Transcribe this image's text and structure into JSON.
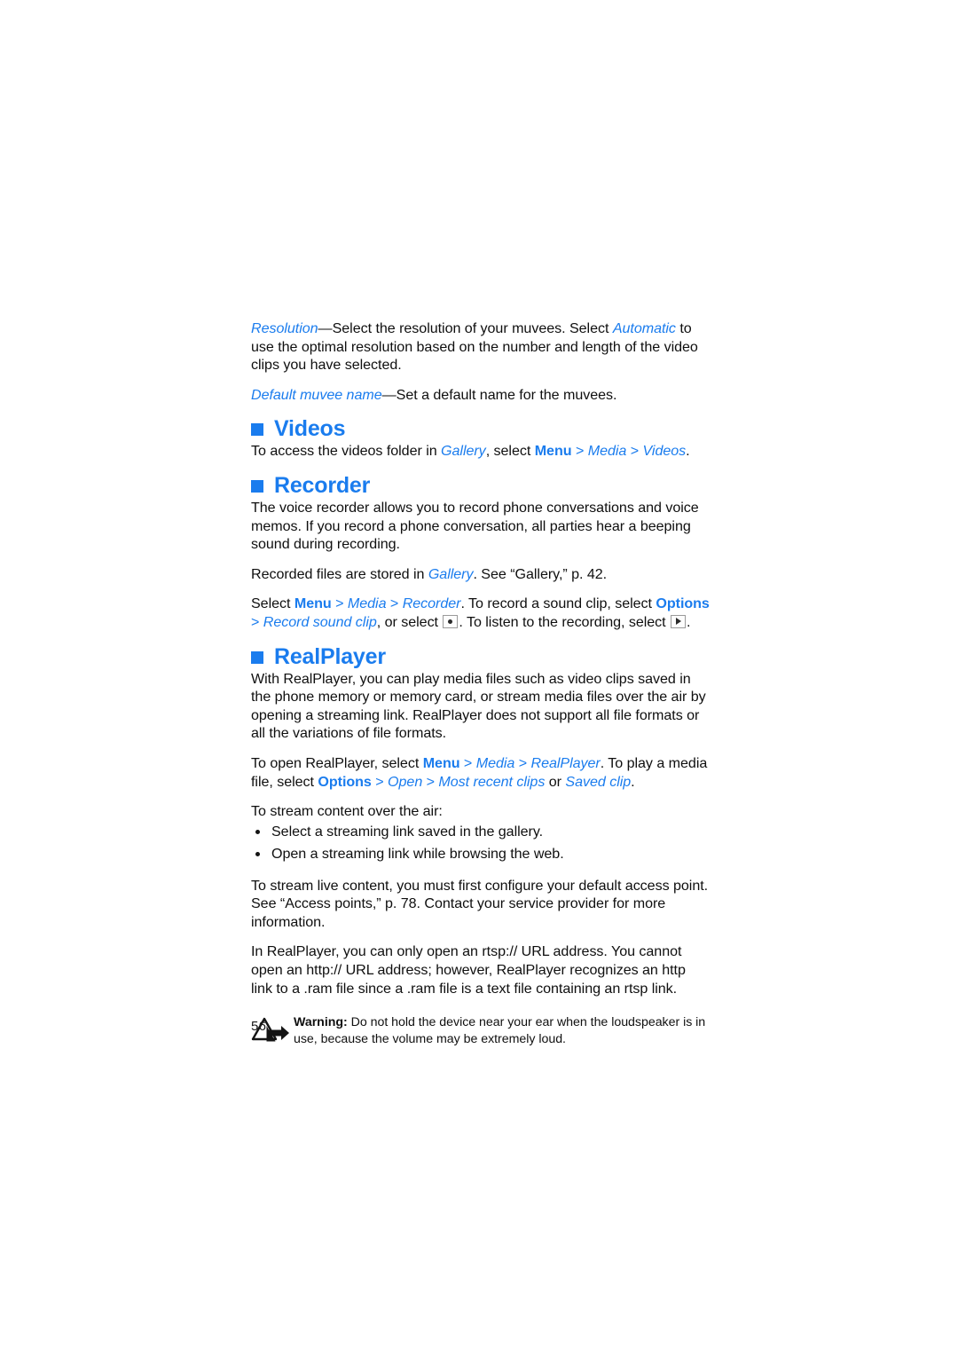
{
  "document": {
    "page_number": "56",
    "accent_color": "#1a7cee",
    "text_color": "#0f0f0f"
  },
  "muvee_settings": {
    "resolution": {
      "term": "Resolution",
      "dash": "—",
      "text_1": "Select the resolution of your muvees. Select ",
      "term_2": "Automatic",
      "text_2": " to use the optimal resolution based on the number and length of the video clips you have selected."
    },
    "default_name": {
      "term": "Default muvee name",
      "dash": "—",
      "text": "Set a default name for the muvees."
    }
  },
  "videos": {
    "heading": "Videos",
    "icon": "blue-square-bullet",
    "intro": {
      "text_1": "To access the videos folder in ",
      "term_gallery": "Gallery",
      "text_2": ", select ",
      "softkey_menu": "Menu",
      "sep_1": " > ",
      "item_media": "Media",
      "sep_2": " > ",
      "item_videos": "Videos",
      "text_3": "."
    }
  },
  "recorder": {
    "heading": "Recorder",
    "icon": "blue-square-bullet",
    "paragraph_1": "The voice recorder allows you to record phone conversations and voice memos. If you record a phone conversation, all parties hear a beeping sound during recording.",
    "paragraph_2": {
      "text_1": "Recorded files are stored in ",
      "term_gallery": "Gallery",
      "text_2": ". See “Gallery,” p. 42."
    },
    "paragraph_3": {
      "text_1": "Select ",
      "softkey_menu": "Menu",
      "sep_1": " > ",
      "item_media": "Media",
      "sep_2": " > ",
      "item_recorder": "Recorder",
      "text_2": ". To record a sound clip, select ",
      "softkey_options": "Options",
      "sep_3": " > ",
      "item_record_sound_clip": "Record sound clip",
      "text_3": ", or select ",
      "icon_record": "record-key-icon",
      "text_4": ". To listen to the recording, select ",
      "icon_play": "play-key-icon",
      "text_5": "."
    }
  },
  "realplayer": {
    "heading": "RealPlayer",
    "icon": "blue-square-bullet",
    "paragraph_1": "With RealPlayer, you can play media files such as video clips saved in the phone memory or memory card, or stream media files over the air by opening a streaming link. RealPlayer does not support all file formats or all the variations of file formats.",
    "paragraph_2": {
      "text_1": "To open RealPlayer, select ",
      "softkey_menu": "Menu",
      "sep_1": " > ",
      "item_media": "Media",
      "sep_2": " > ",
      "item_realplayer": "RealPlayer",
      "text_2": ". To play a media file, select ",
      "softkey_options": "Options",
      "sep_3": " > ",
      "item_open": "Open",
      "sep_4": " > ",
      "item_most_recent_clips": "Most recent clips",
      "text_3": " or ",
      "item_saved_clip": "Saved clip",
      "text_4": "."
    },
    "stream_intro": "To stream content over the air:",
    "stream_bullets": [
      "Select a streaming link saved in the gallery.",
      "Open a streaming link while browsing the web."
    ],
    "paragraph_3": "To stream live content, you must first configure your default access point. See “Access points,” p. 78. Contact your service provider for more information.",
    "paragraph_4": "In RealPlayer, you can only open an rtsp:// URL address. You cannot open an http:// URL address; however, RealPlayer recognizes an http link to a .ram file since a .ram file is a text file containing an rtsp link."
  },
  "warning": {
    "icon": "warning-triangle-arrow-icon",
    "label": "Warning:",
    "text": " Do not hold the device near your ear when the loudspeaker is in use, because the volume may be extremely loud."
  }
}
